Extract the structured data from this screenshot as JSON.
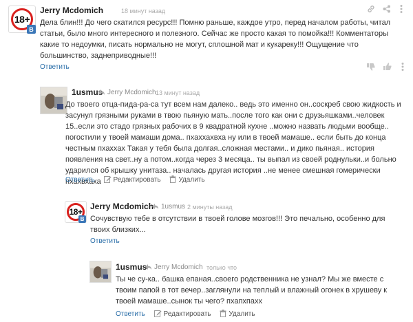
{
  "comments": [
    {
      "author": "Jerry Mcdomich",
      "time": "18 минут назад",
      "avatar": "18+",
      "badge": "B",
      "text": "Дела блин!!! До чего скатился ресурс!!! Помню раньше, каждое утро, перед началом работы, читал статьи, было много интересного и полезного. Сейчас же просто какая то помойка!!! Комментаторы какие то недоумки, писать нормально не могут, сплошной мат и кукареку!!! Ощущение что большинство, заднеприводные!!!",
      "reply": "Ответить"
    },
    {
      "author": "1usmus",
      "reply_to": "Jerry Mcdomich",
      "time": "13 минут назад",
      "text": "До твоего отца-пида-ра-са тут всем нам далеко.. ведь это именно он..соскреб свою жидкость и засунул грязными руками в твою пьяную мать..после того как они с друзьяшками..человек 15..если это стадо грязных рабочих в 9 квадратной кухне ..можно назвать людьми вообще.. погостили у твоей мамаши дома.. пхаххахвха ну или в твоей мамаше.. если быть до конца честным пхаххах Такая у тебя была долгая..сложная местами.. и дико пьяная.. история появления на свет..ну а потом..когда  через 3 месяца.. ты выпал из своей роднульки..и больно ударился об крышку унитаза.. началась другая история ..не менее смешная гомерически пхахвхаха",
      "reply": "Ответить",
      "edit": "Редактировать",
      "delete": "Удалить"
    },
    {
      "author": "Jerry Mcdomich",
      "reply_to": "1usmus",
      "time": "2 минуты назад",
      "avatar": "18+",
      "badge": "B",
      "text": "Сочувствую тебе в отсутствии в твоей голове мозгов!!! Это печально, особенно для твоих близких...",
      "reply": "Ответить"
    },
    {
      "author": "1usmus",
      "reply_to": "Jerry Mcdomich",
      "time": "только что",
      "text": "Ты че су-ка.. башка епаная..своего родственника не узнал? Мы же вместе с твоим папой в тот вечер..заглянули на теплый и влажный огонек  в хрушеву к твоей мамаше..сынок ты чего? пхапхпахх",
      "reply": "Ответить",
      "edit": "Редактировать",
      "delete": "Удалить"
    }
  ],
  "icons": [
    "link-icon",
    "share-icon",
    "more-icon",
    "thumb-down-icon",
    "thumb-up-icon",
    "reply-arrow-icon",
    "edit-icon",
    "trash-icon"
  ]
}
